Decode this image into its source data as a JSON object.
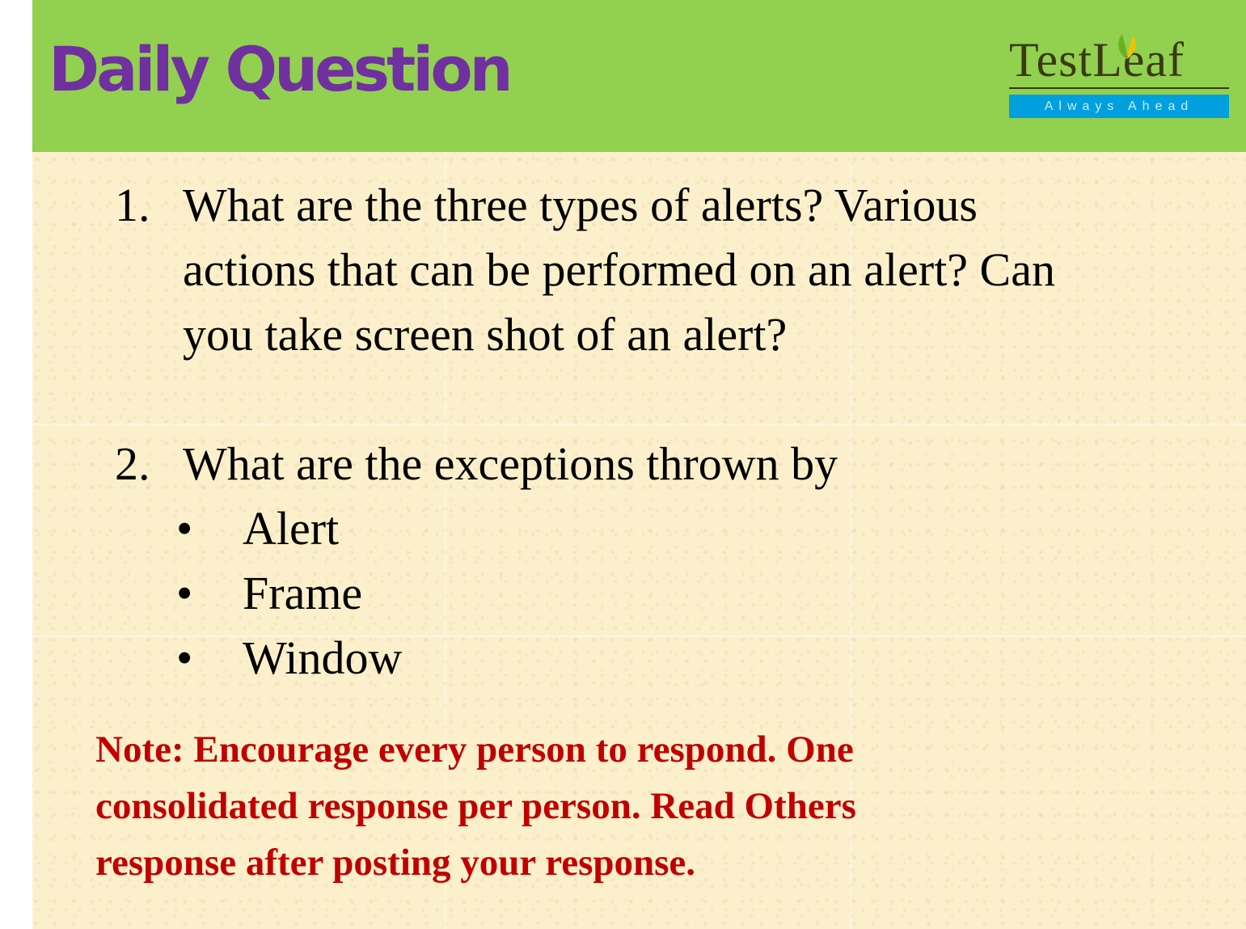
{
  "header": {
    "title": "Daily Question",
    "background_color": "#92d050",
    "title_color": "#7030a0"
  },
  "logo": {
    "brand": "TestLeaf",
    "tagline": "Always Ahead",
    "icon": "leaf-icon"
  },
  "questions": [
    {
      "number": "1.",
      "lines": [
        "What are the three types of alerts? Various",
        "actions that can be performed on an alert? Can",
        "you take screen shot of an alert?"
      ]
    },
    {
      "number": "2.",
      "lines": [
        "What are the exceptions thrown by"
      ],
      "bullets": [
        "Alert",
        "Frame",
        "Window"
      ]
    }
  ],
  "bullet_symbol": "•",
  "note": {
    "lines": [
      "Note: Encourage every person to respond. One",
      "consolidated response per person. Read Others",
      "response after posting your response."
    ],
    "color": "#c00000"
  }
}
